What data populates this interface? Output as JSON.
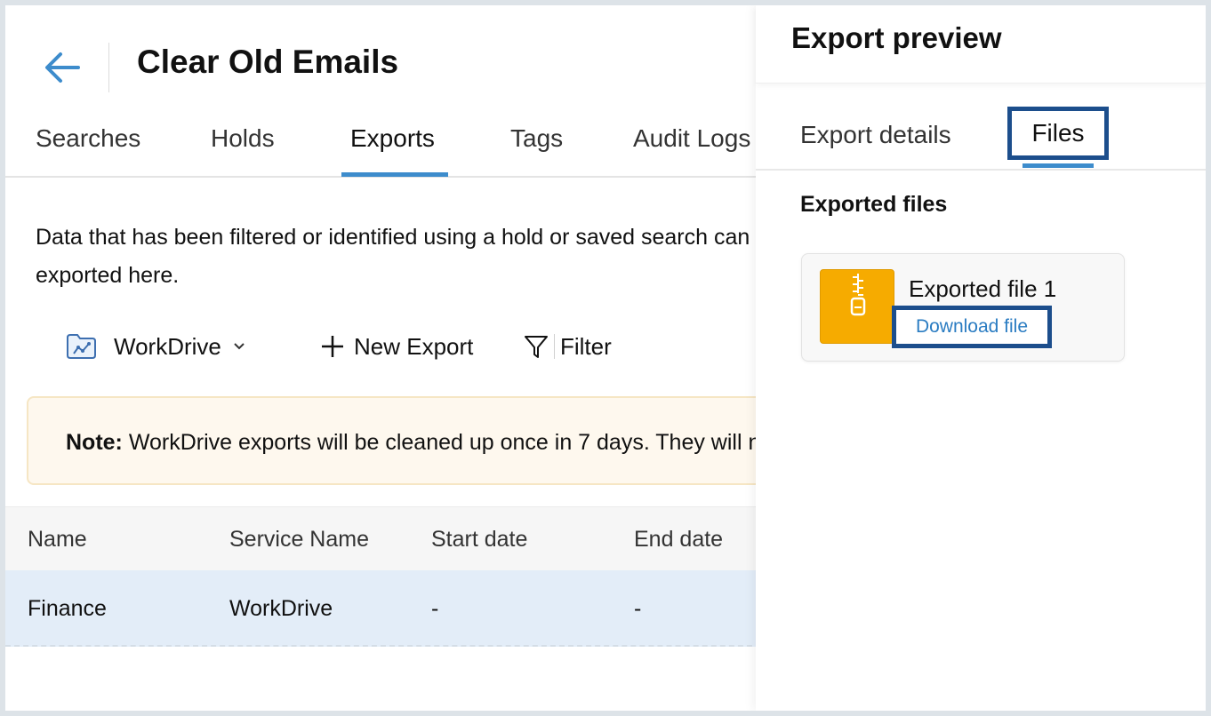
{
  "header": {
    "title": "Clear Old Emails"
  },
  "tabs": [
    {
      "label": "Searches",
      "active": false
    },
    {
      "label": "Holds",
      "active": false
    },
    {
      "label": "Exports",
      "active": true
    },
    {
      "label": "Tags",
      "active": false
    },
    {
      "label": "Audit Logs",
      "active": false
    }
  ],
  "description": "Data that has been filtered or identified using a hold or saved search can be exported here.",
  "toolbar": {
    "service": "WorkDrive",
    "new_export": "New Export",
    "filter": "Filter"
  },
  "note": {
    "label": "Note:",
    "text": " WorkDrive exports will be cleaned up once in 7 days. They will no longer be available."
  },
  "table": {
    "columns": [
      "Name",
      "Service Name",
      "Start date",
      "End date"
    ],
    "rows": [
      [
        "Finance",
        "WorkDrive",
        "-",
        "-"
      ]
    ]
  },
  "panel": {
    "title": "Export preview",
    "tabs": [
      {
        "label": "Export details",
        "active": false
      },
      {
        "label": "Files",
        "active": true
      }
    ],
    "section_title": "Exported files",
    "files": [
      {
        "name": "Exported file 1",
        "action": "Download file"
      }
    ]
  },
  "colors": {
    "accent": "#3d8ccc",
    "highlight_border": "#1c4e8c",
    "link": "#2a7cc2",
    "zip_icon": "#f6ab00",
    "row_selected": "#e3edf8",
    "note_bg": "#fef8ee"
  },
  "icons": [
    "back-arrow-icon",
    "workdrive-folder-icon",
    "chevron-down-icon",
    "plus-icon",
    "filter-icon",
    "zip-file-icon"
  ]
}
